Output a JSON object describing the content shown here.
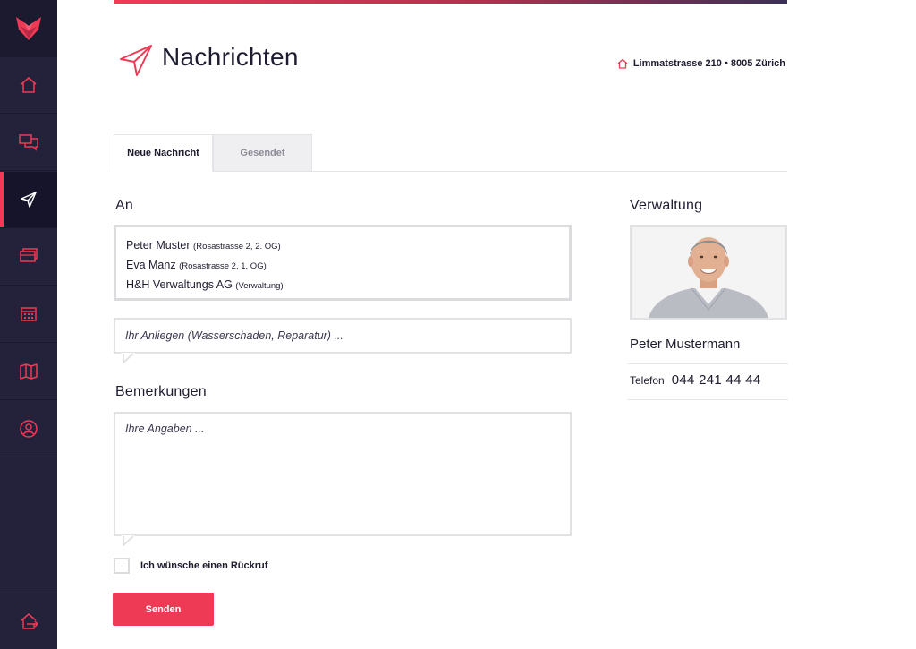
{
  "header": {
    "title": "Nachrichten",
    "address": "Limmatstrasse 210 • 8005 Zürich"
  },
  "sidebar": {
    "items": [
      {
        "name": "home",
        "icon": "home-icon"
      },
      {
        "name": "messages",
        "icon": "chat-icon"
      },
      {
        "name": "send",
        "icon": "paper-plane-icon",
        "active": true
      },
      {
        "name": "documents",
        "icon": "stack-icon"
      },
      {
        "name": "calendar",
        "icon": "calendar-icon"
      },
      {
        "name": "map",
        "icon": "map-icon"
      },
      {
        "name": "profile",
        "icon": "user-icon"
      }
    ],
    "logout_icon": "logout-icon"
  },
  "tabs": [
    {
      "label": "Neue Nachricht",
      "active": true
    },
    {
      "label": "Gesendet",
      "active": false
    }
  ],
  "form": {
    "to_label": "An",
    "recipients": [
      {
        "name": "Peter Muster",
        "detail": "(Rosastrasse 2, 2. OG)"
      },
      {
        "name": "Eva Manz",
        "detail": "(Rosastrasse 2, 1. OG)"
      },
      {
        "name": "H&H Verwaltungs AG",
        "detail": "(Verwaltung)"
      }
    ],
    "concern_placeholder": "Ihr Anliegen (Wasserschaden, Reparatur) ...",
    "remarks_label": "Bemerkungen",
    "remarks_placeholder": "Ihre Angaben ...",
    "callback_label": "Ich wünsche einen Rückruf",
    "callback_checked": false,
    "submit_label": "Senden"
  },
  "contact": {
    "section_label": "Verwaltung",
    "name": "Peter Mustermann",
    "phone_label": "Telefon",
    "phone": "044 241 44 44"
  },
  "colors": {
    "accent": "#ee3a55",
    "sidebar": "#23223a",
    "text": "#1e1d30"
  }
}
